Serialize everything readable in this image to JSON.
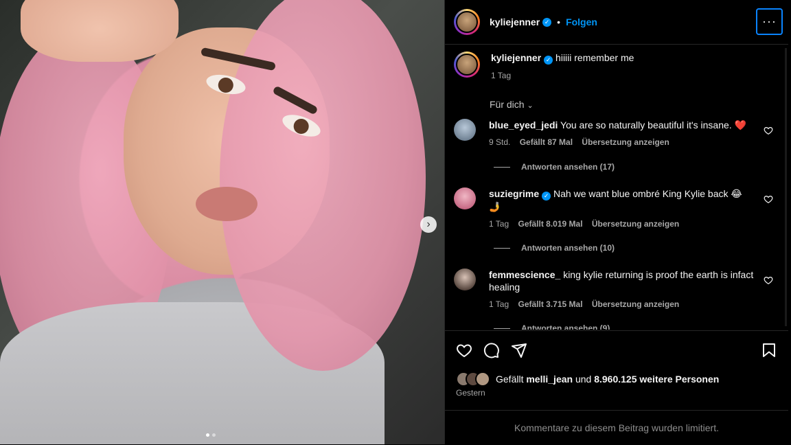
{
  "post": {
    "username": "kyliejenner",
    "follow_label": "Folgen",
    "separator": "•",
    "more_label": "···"
  },
  "caption": {
    "username": "kyliejenner",
    "text": "hiiiii remember me",
    "time": "1 Tag"
  },
  "sort_label": "Für dich",
  "comments": [
    {
      "username": "blue_eyed_jedi",
      "text": "You are so naturally beautiful it's insane. ❤️",
      "time": "9 Std.",
      "likes": "Gefällt 87 Mal",
      "translate": "Übersetzung anzeigen",
      "replies": "Antworten ansehen (17)"
    },
    {
      "username": "suziegrime",
      "text": "Nah we want blue ombré King Kylie back 😂 🤳",
      "time": "1 Tag",
      "likes": "Gefällt 8.019 Mal",
      "translate": "Übersetzung anzeigen",
      "replies": "Antworten ansehen (10)"
    },
    {
      "username": "femmescience_",
      "text": "king kylie returning is proof the earth is infact healing",
      "time": "1 Tag",
      "likes": "Gefällt 3.715 Mal",
      "translate": "Übersetzung anzeigen",
      "replies": "Antworten ansehen (9)"
    }
  ],
  "likes_row": {
    "prefix": "Gefällt",
    "user": "melli_jean",
    "middle": "und",
    "others": "8.960.125 weitere Personen"
  },
  "date": "Gestern",
  "footer": "Kommentare zu diesem Beitrag wurden limitiert.",
  "colors": {
    "accent": "#0095f6",
    "background": "#000000",
    "muted": "#a8a8a8",
    "border": "#262626"
  },
  "icons": [
    "verified-icon",
    "more-options-icon",
    "chevron-down-icon",
    "heart-icon",
    "comment-icon",
    "share-icon",
    "bookmark-icon",
    "next-arrow-icon"
  ]
}
